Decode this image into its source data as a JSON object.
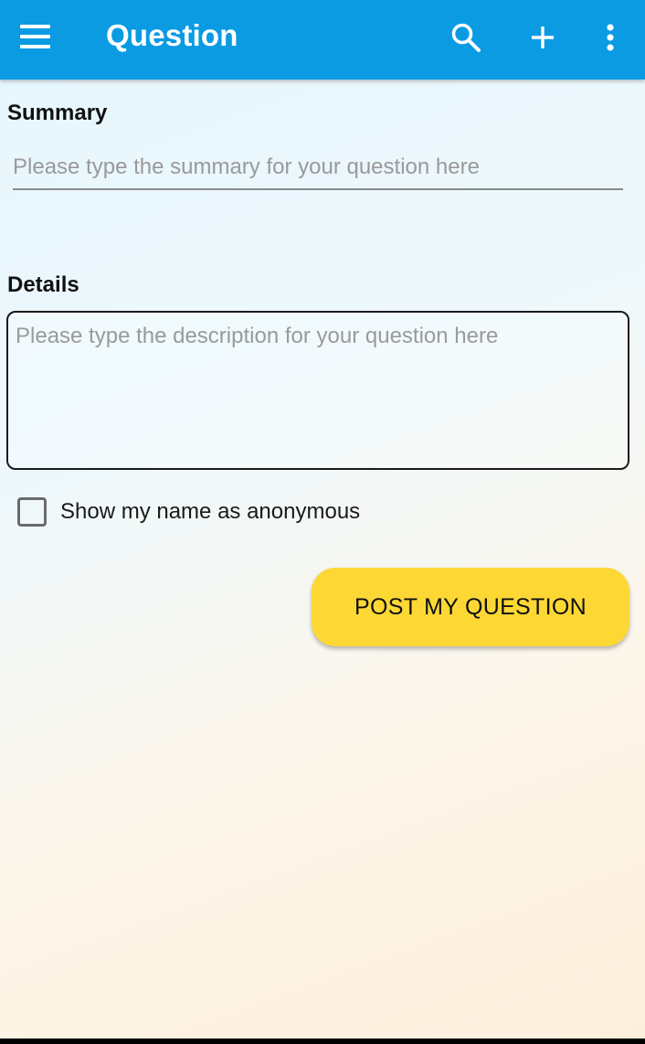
{
  "colors": {
    "app_bar": "#0a9be3",
    "button": "#fdd835",
    "text": "#111111",
    "placeholder": "#9a9a9a"
  },
  "app_bar": {
    "title": "Question",
    "icons": {
      "menu": "menu-icon",
      "search": "search-icon",
      "add": "plus-icon",
      "more": "more-vertical-icon"
    }
  },
  "form": {
    "summary": {
      "label": "Summary",
      "value": "",
      "placeholder": "Please type the summary for your question here"
    },
    "details": {
      "label": "Details",
      "value": "",
      "placeholder": "Please type the description for your question here"
    },
    "anonymous": {
      "label": "Show my name as anonymous",
      "checked": false
    },
    "submit_label": "POST MY QUESTION"
  }
}
